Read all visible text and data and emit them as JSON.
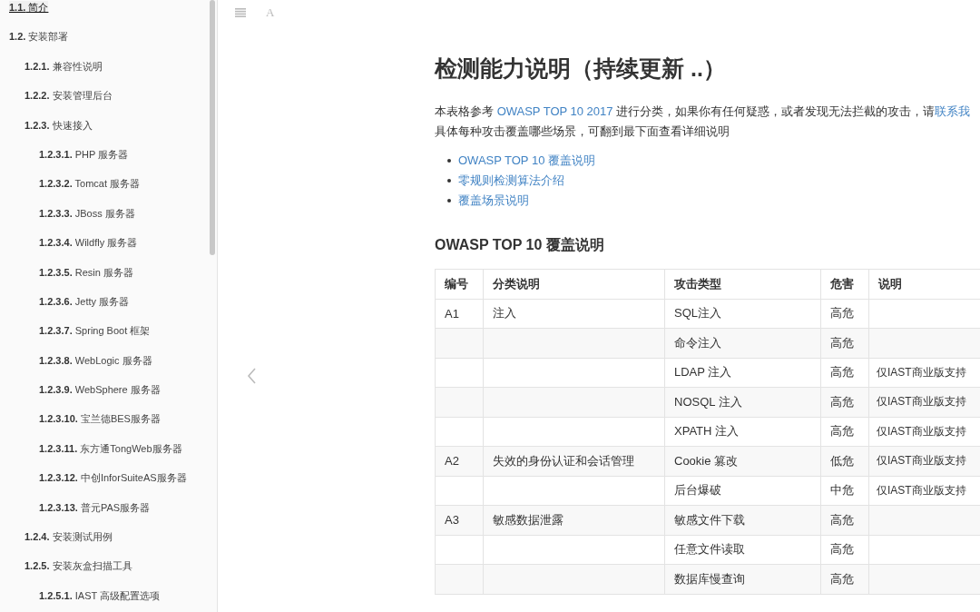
{
  "sidebar": {
    "items": [
      {
        "label": "**1.1.** 简介",
        "selected": true
      },
      {
        "label": "**1.2.** 安装部署",
        "selected": false,
        "children": [
          {
            "label": "**1.2.1.** 兼容性说明",
            "selected": false
          },
          {
            "label": "**1.2.2.** 安装管理后台",
            "selected": false
          },
          {
            "label": "**1.2.3.** 快速接入",
            "selected": false,
            "children": [
              {
                "label": "**1.2.3.1.** PHP 服务器",
                "selected": false
              },
              {
                "label": "**1.2.3.2.** Tomcat 服务器",
                "selected": false
              },
              {
                "label": "**1.2.3.3.** JBoss 服务器",
                "selected": false
              },
              {
                "label": "**1.2.3.4.** Wildfly 服务器",
                "selected": false
              },
              {
                "label": "**1.2.3.5.** Resin 服务器",
                "selected": false
              },
              {
                "label": "**1.2.3.6.** Jetty 服务器",
                "selected": false
              },
              {
                "label": "**1.2.3.7.** Spring Boot 框架",
                "selected": false
              },
              {
                "label": "**1.2.3.8.** WebLogic 服务器",
                "selected": false
              },
              {
                "label": "**1.2.3.9.** WebSphere 服务器",
                "selected": false
              },
              {
                "label": "**1.2.3.10.** 宝兰德BES服务器",
                "selected": false
              },
              {
                "label": "**1.2.3.11.** 东方通TongWeb服务器",
                "selected": false
              },
              {
                "label": "**1.2.3.12.** 中创InforSuiteAS服务器",
                "selected": false
              },
              {
                "label": "**1.2.3.13.** 普元PAS服务器",
                "selected": false
              }
            ]
          },
          {
            "label": "**1.2.4.** 安装测试用例",
            "selected": false
          },
          {
            "label": "**1.2.5.** 安装灰盒扫描工具",
            "selected": false,
            "children": [
              {
                "label": "**1.2.5.1.** IAST 高级配置选项",
                "selected": false
              }
            ]
          }
        ]
      }
    ]
  },
  "toolbar": {
    "font_button": "A"
  },
  "article": {
    "title": "检测能力说明（持续更新 ..）",
    "intro_line_1": [
      {
        "kind": "text",
        "text": "本表格参考 "
      },
      {
        "kind": "link",
        "text": "OWASP TOP 10 2017"
      },
      {
        "kind": "text",
        "text": " 进行分类，如果你有任何疑惑，或者发现无法拦截的攻击，请"
      },
      {
        "kind": "link",
        "text": "联系我"
      }
    ],
    "intro_line_2": "具体每种攻击覆盖哪些场景，可翻到最下面查看详细说明",
    "toc": [
      "OWASP TOP 10 覆盖说明",
      "零规则检测算法介绍",
      "覆盖场景说明"
    ],
    "section_title": "OWASP TOP 10 覆盖说明",
    "table": {
      "columns": [
        "编号",
        "分类说明",
        "攻击类型",
        "危害",
        "说明"
      ],
      "rows": [
        [
          "A1",
          "注入",
          "SQL注入",
          "高危",
          ""
        ],
        [
          "",
          "",
          "命令注入",
          "高危",
          ""
        ],
        [
          "",
          "",
          "LDAP 注入",
          "高危",
          "仅IAST商业版支持"
        ],
        [
          "",
          "",
          "NOSQL 注入",
          "高危",
          "仅IAST商业版支持"
        ],
        [
          "",
          "",
          "XPATH 注入",
          "高危",
          "仅IAST商业版支持"
        ],
        [
          "A2",
          "失效的身份认证和会话管理",
          "Cookie 篡改",
          "低危",
          "仅IAST商业版支持"
        ],
        [
          "",
          "",
          "后台爆破",
          "中危",
          "仅IAST商业版支持"
        ],
        [
          "A3",
          "敏感数据泄露",
          "敏感文件下载",
          "高危",
          ""
        ],
        [
          "",
          "",
          "任意文件读取",
          "高危",
          ""
        ],
        [
          "",
          "",
          "数据库慢查询",
          "高危",
          ""
        ]
      ]
    }
  }
}
